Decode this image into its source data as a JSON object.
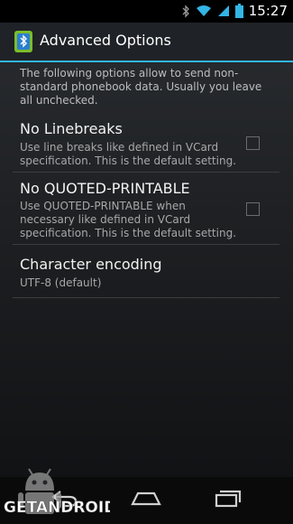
{
  "status": {
    "time": "15:27"
  },
  "app": {
    "title": "Advanced Options"
  },
  "intro": "The following options allow to send non-standard phonebook data. Usually you leave all unchecked.",
  "prefs": [
    {
      "title": "No Linebreaks",
      "summary": "Use line breaks like defined in VCard specification. This is the default setting.",
      "checked": false
    },
    {
      "title": "No QUOTED-PRINTABLE",
      "summary": "Use QUOTED-PRINTABLE when necessary like defined in VCard specification. This is the default setting.",
      "checked": false
    },
    {
      "title": "Character encoding",
      "summary": "UTF-8 (default)"
    }
  ],
  "nav": {
    "back": "back-icon",
    "home": "home-icon",
    "recents": "recents-icon"
  },
  "watermark": {
    "text": "GETANDROID"
  },
  "colors": {
    "accent": "#33b5e5",
    "icon_green": "#7bbd2a",
    "status_bar": "#000000"
  }
}
